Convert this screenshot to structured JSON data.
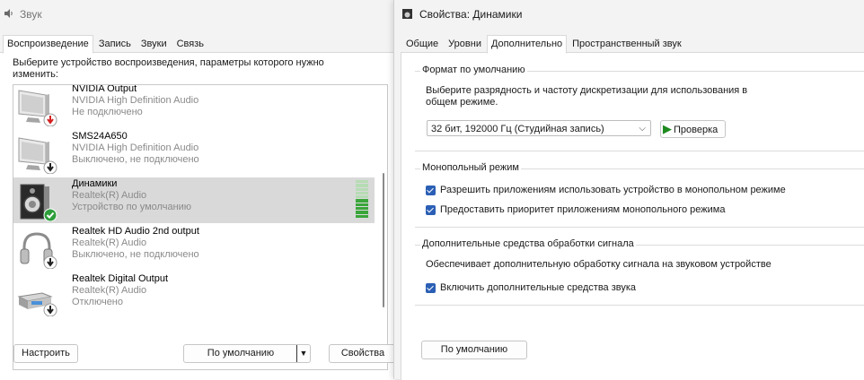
{
  "sound_window": {
    "title": "Звук",
    "tabs": [
      {
        "label": "Воспроизведение",
        "active": true
      },
      {
        "label": "Запись",
        "active": false
      },
      {
        "label": "Звуки",
        "active": false
      },
      {
        "label": "Связь",
        "active": false
      }
    ],
    "description": "Выберите устройство воспроизведения, параметры которого нужно изменить:",
    "devices": [
      {
        "name": "NVIDIA Output",
        "driver": "NVIDIA High Definition Audio",
        "status": "Не подключено",
        "icon": "monitor-icon",
        "badge": "disconnected-badge-icon",
        "selected": false
      },
      {
        "name": "SMS24A650",
        "driver": "NVIDIA High Definition Audio",
        "status": "Выключено, не подключено",
        "icon": "monitor-icon",
        "badge": "disabled-badge-icon",
        "selected": false
      },
      {
        "name": "Динамики",
        "driver": "Realtek(R) Audio",
        "status": "Устройство по умолчанию",
        "icon": "speaker-icon",
        "badge": "default-check-icon",
        "selected": true
      },
      {
        "name": "Realtek HD Audio 2nd output",
        "driver": "Realtek(R) Audio",
        "status": "Выключено, не подключено",
        "icon": "headphones-icon",
        "badge": "disabled-badge-icon",
        "selected": false
      },
      {
        "name": "Realtek Digital Output",
        "driver": "Realtek(R) Audio",
        "status": "Отключено",
        "icon": "digital-output-icon",
        "badge": "disabled-badge-icon",
        "selected": false
      }
    ],
    "level_meter": {
      "level_fraction": 0.5
    },
    "buttons": {
      "configure": "Настроить",
      "set_default": "По умолчанию",
      "properties": "Свойства"
    }
  },
  "properties_window": {
    "title": "Свойства: Динамики",
    "tabs": [
      {
        "label": "Общие",
        "active": false
      },
      {
        "label": "Уровни",
        "active": false
      },
      {
        "label": "Дополнительно",
        "active": true
      },
      {
        "label": "Пространственный звук",
        "active": false
      }
    ],
    "default_format": {
      "group_label": "Формат по умолчанию",
      "description": "Выберите разрядность и частоту дискретизации для использования в общем режиме.",
      "selected_format": "32 бит, 192000 Гц (Студийная запись)",
      "test_button": "Проверка"
    },
    "exclusive_mode": {
      "group_label": "Монопольный режим",
      "options": [
        {
          "label": "Разрешить приложениям использовать устройство в монопольном режиме",
          "checked": true
        },
        {
          "label": "Предоставить приоритет приложениям монопольного режима",
          "checked": true
        }
      ]
    },
    "enhancements": {
      "group_label": "Дополнительные средства обработки сигнала",
      "description": "Обеспечивает дополнительную обработку сигнала на звуковом устройстве",
      "option": {
        "label": "Включить дополнительные средства звука",
        "checked": true
      }
    },
    "restore_defaults_button": "По умолчанию"
  },
  "colors": {
    "accent": "#2b5fb5",
    "selection": "#d9d9d9",
    "level_green": "#3aa63a",
    "play_green": "#1f8a1f",
    "disconnected_red": "#d42020"
  }
}
